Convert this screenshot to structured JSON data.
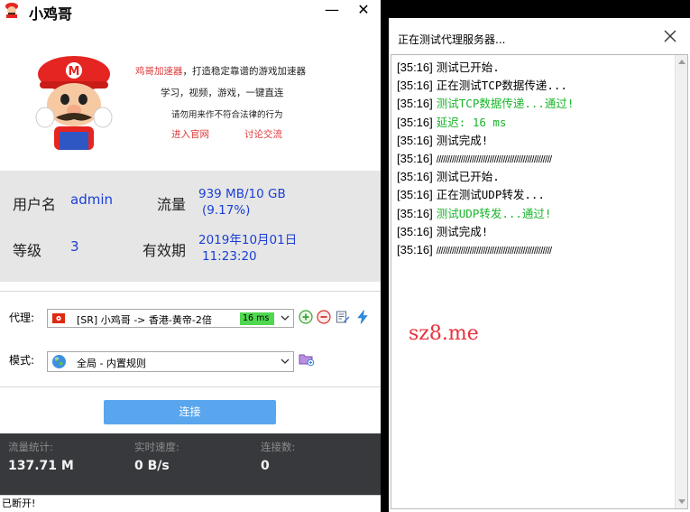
{
  "left_window": {
    "title": "小鸡哥",
    "minimize_glyph": "—",
    "close_glyph": "✕",
    "promo": {
      "brand": "鸡哥加速器",
      "line1_rest": "，打造稳定靠谱的游戏加速器",
      "line2": "学习，视频，游戏，一键直连",
      "line3": "请勿用来作不符合法律的行为",
      "link_site": "进入官网",
      "link_forum": "讨论交流"
    },
    "account": {
      "user_label": "用户名",
      "user_value": "admin",
      "traffic_label": "流量",
      "traffic_value": "939 MB/10 GB",
      "traffic_percent": "(9.17%)",
      "level_label": "等级",
      "level_value": "3",
      "expire_label": "有效期",
      "expire_date": "2019年10月01日",
      "expire_time": "11:23:20"
    },
    "proxy": {
      "label": "代理:",
      "selected": "[SR] 小鸡哥 -> 香港-黄帝-2倍",
      "latency": "16 ms"
    },
    "mode": {
      "label": "模式:",
      "selected": "全局 - 内置规则"
    },
    "connect_label": "连接",
    "stats": {
      "traffic_label": "流量统计:",
      "traffic_value": "137.71 M",
      "speed_label": "实时速度:",
      "speed_value": "0 B/s",
      "conn_label": "连接数:",
      "conn_value": "0"
    },
    "status": "已断开!"
  },
  "right_window": {
    "title": "正在测试代理服务器...",
    "log": [
      {
        "ts": "[35:16]",
        "msg": "测试已开始.",
        "color": "black"
      },
      {
        "ts": "[35:16]",
        "msg": "正在测试TCP数据传递...",
        "color": "black"
      },
      {
        "ts": "[35:16]",
        "msg": "测试TCP数据传递...通过!",
        "color": "green"
      },
      {
        "ts": "[35:16]",
        "msg": "延迟: 16 ms",
        "color": "green"
      },
      {
        "ts": "[35:16]",
        "msg": "测试完成!",
        "color": "black"
      },
      {
        "ts": "[35:16]",
        "msg": "////////////////////////////////////////////////////",
        "color": "black"
      },
      {
        "ts": "[35:16]",
        "msg": "测试已开始.",
        "color": "black"
      },
      {
        "ts": "[35:16]",
        "msg": "正在测试UDP转发...",
        "color": "black"
      },
      {
        "ts": "[35:16]",
        "msg": "测试UDP转发...通过!",
        "color": "green"
      },
      {
        "ts": "[35:16]",
        "msg": "测试完成!",
        "color": "black"
      },
      {
        "ts": "[35:16]",
        "msg": "////////////////////////////////////////////////////",
        "color": "black"
      }
    ],
    "watermark": "sz8.me"
  },
  "colors": {
    "accent_blue": "#59a6ee",
    "value_blue": "#1a3fd6",
    "promo_red": "#e23a3a",
    "log_green": "#19b52a",
    "latency_green": "#4fd84f",
    "stats_bg": "#37393c"
  },
  "icons": [
    "mario-logo-icon",
    "hong-kong-flag-icon",
    "globe-icon",
    "add-icon",
    "remove-icon",
    "edit-icon",
    "lightning-icon",
    "mode-settings-icon",
    "chevron-down-icon",
    "close-icon"
  ]
}
